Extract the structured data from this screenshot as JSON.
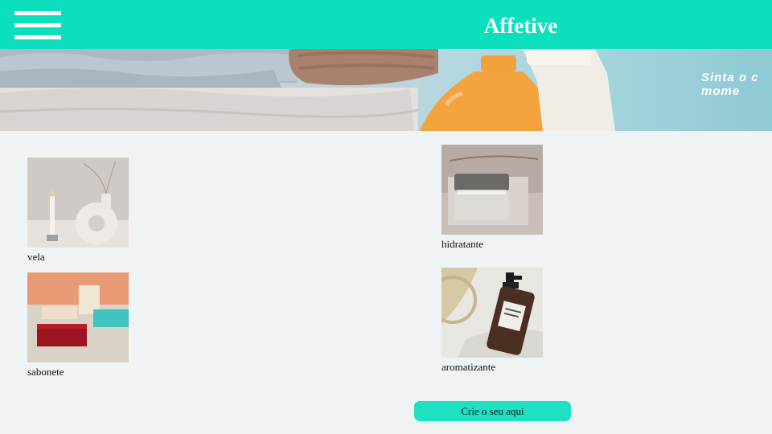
{
  "header": {
    "brand": "Affetive",
    "menu_icon": "hamburger-menu-icon"
  },
  "banner": {
    "text": "Sinta o c\nmome"
  },
  "products": [
    {
      "label": "vela"
    },
    {
      "label": "hidratante"
    },
    {
      "label": "sabonete"
    },
    {
      "label": "aromatizante"
    }
  ],
  "cta": {
    "label": "Crie o seu aqui"
  },
  "colors": {
    "header_bg": "#0bdfbe",
    "page_bg": "#eff3f3",
    "cta_bg": "#1ee0c2"
  }
}
